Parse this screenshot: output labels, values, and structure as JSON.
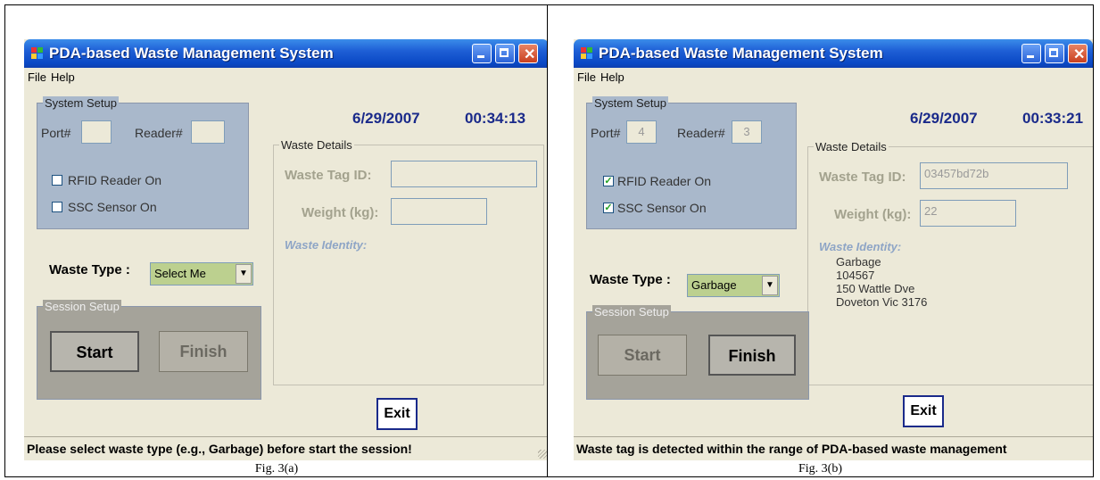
{
  "figures": [
    {
      "caption": "Fig. 3(a)",
      "window": {
        "title": "PDA-based Waste Management System",
        "menu": [
          "File",
          "Help"
        ],
        "date": "6/29/2007",
        "time": "00:34:13",
        "system_setup": {
          "legend": "System Setup",
          "port_label": "Port#",
          "port_value": "",
          "reader_label": "Reader#",
          "reader_value": "",
          "rfid_label": "RFID Reader On",
          "rfid_checked": false,
          "ssc_label": "SSC Sensor On",
          "ssc_checked": false
        },
        "waste_details": {
          "legend": "Waste Details",
          "tag_label": "Waste Tag ID:",
          "tag_value": "",
          "weight_label": "Weight (kg):",
          "weight_value": "",
          "identity_label": "Waste Identity:",
          "identity_lines": []
        },
        "waste_type_label": "Waste Type :",
        "waste_type_value": "Select Me",
        "session_setup": {
          "legend": "Session Setup",
          "start": "Start",
          "finish": "Finish"
        },
        "exit": "Exit",
        "status": "Please select waste type (e.g., Garbage) before start the session!"
      }
    },
    {
      "caption": "Fig. 3(b)",
      "window": {
        "title": "PDA-based Waste Management System",
        "menu": [
          "File",
          "Help"
        ],
        "date": "6/29/2007",
        "time": "00:33:21",
        "system_setup": {
          "legend": "System Setup",
          "port_label": "Port#",
          "port_value": "4",
          "reader_label": "Reader#",
          "reader_value": "3",
          "rfid_label": "RFID Reader On",
          "rfid_checked": true,
          "ssc_label": "SSC Sensor On",
          "ssc_checked": true
        },
        "waste_details": {
          "legend": "Waste Details",
          "tag_label": "Waste Tag ID:",
          "tag_value": "03457bd72b",
          "weight_label": "Weight (kg):",
          "weight_value": "22",
          "identity_label": "Waste Identity:",
          "identity_lines": [
            "Garbage",
            "104567",
            "150 Wattle Dve",
            "Doveton Vic 3176"
          ]
        },
        "waste_type_label": "Waste Type :",
        "waste_type_value": "Garbage",
        "session_setup": {
          "legend": "Session Setup",
          "start": "Start",
          "finish": "Finish"
        },
        "exit": "Exit",
        "status": "Waste tag is detected within the range of PDA-based waste management"
      }
    }
  ],
  "icons": {
    "minimize": "minimize-icon",
    "maximize": "maximize-icon",
    "close": "close-icon",
    "dropdown": "chevron-down-icon",
    "app": "app-icon"
  },
  "colors": {
    "titlebar": "#0a48c4",
    "system_group": "#a9b8cb",
    "session_group": "#a5a39a",
    "combo_bg": "#bcd08f",
    "datetime": "#1a2a8a"
  }
}
